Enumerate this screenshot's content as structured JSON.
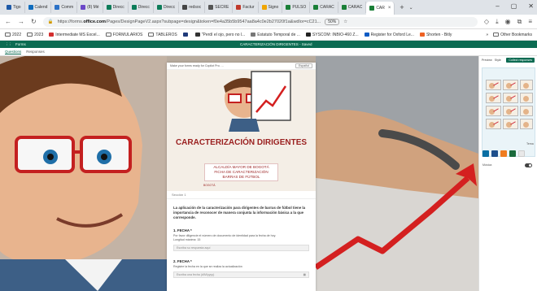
{
  "browser": {
    "tabs": [
      {
        "label": "Tigo",
        "color": "#1e5aa8"
      },
      {
        "label": "Calend",
        "color": "#0f6cbd"
      },
      {
        "label": "Comm",
        "color": "#2c72c7"
      },
      {
        "label": "(8) Mé",
        "color": "#6b47c8"
      },
      {
        "label": "Direcc",
        "color": "#0c7c59"
      },
      {
        "label": "Direcc",
        "color": "#0c7c59"
      },
      {
        "label": "Direcc",
        "color": "#0c7c59"
      },
      {
        "label": "redsoc",
        "color": "#444444"
      },
      {
        "label": "SECRE",
        "color": "#555555"
      },
      {
        "label": "Factur",
        "color": "#c0392b"
      },
      {
        "label": "Signo",
        "color": "#f0a500"
      },
      {
        "label": "PULSO",
        "color": "#1a7f37"
      },
      {
        "label": "CARAC",
        "color": "#1a7f37"
      },
      {
        "label": "CARAC",
        "color": "#1a7f37"
      },
      {
        "label": "CAR",
        "color": "#1a7f37",
        "active": true
      }
    ],
    "new_tab": "+",
    "tab_menu": "⌄",
    "url_prefix": "https://forms.",
    "url_domain": "office.com",
    "url_rest": "/Pages/DesignPageV2.aspx?subpage=design&token=f0e4a35b5b9547aa8a4c0e2b27020f1a&wdlor=cC21...",
    "zoom": "50%",
    "window_controls": [
      "–",
      "▢",
      "✕"
    ]
  },
  "bookmarks": [
    {
      "label": "2022",
      "kind": "folder"
    },
    {
      "label": "2023",
      "kind": "folder"
    },
    {
      "label": "Intermediate MS Excel...",
      "kind": "site",
      "color": "#d32f2f"
    },
    {
      "label": "FORMULARIOS",
      "kind": "folder"
    },
    {
      "label": "TABLEROS",
      "kind": "folder"
    },
    {
      "label": "",
      "kind": "site",
      "color": "#1f3a7a"
    },
    {
      "label": "\"Perdí el ojo, pero no l...",
      "kind": "site",
      "color": "#333333"
    },
    {
      "label": "Estatuto Temporal de ...",
      "kind": "site",
      "color": "#777777"
    },
    {
      "label": "SYSCOM: INBIO-460 Z...",
      "kind": "site",
      "color": "#222222"
    },
    {
      "label": "Register for Oxford Le...",
      "kind": "site",
      "color": "#0f5cc4"
    },
    {
      "label": "Shorten - Bitly",
      "kind": "site",
      "color": "#ee6123"
    }
  ],
  "bookmarks_right": [
    "»",
    "Other Bookmarks"
  ],
  "forms": {
    "app_name": "Forms",
    "doc_title": "CARACTERIZACIÓN DIRIGENTES - Saved",
    "tabs": [
      "Questions",
      "Responses"
    ],
    "panel_actions": [
      "Preview",
      "Style",
      "Collect responses"
    ]
  },
  "card": {
    "top_notice": "Make your forms ready for Copilot Pro. ...",
    "lang_button": "Español",
    "title": "CARACTERIZACIÓN DIRIGENTES",
    "subtitle": "ALCALDÍA MAYOR DE BOGOTÁ\nFICHA DE CARACTERIZACIÓN\nBARRAS DE FÚTBOL",
    "logo_text": "BOGOTÁ",
    "section_label": "Sección 1",
    "intro": "La aplicación de la caracterización para dirigentes de barras de fútbol tiene la importancia de reconocer de manera conjunta la información básica a la que corresponde.",
    "q1": {
      "title": "1. FECHA *",
      "desc": "Por favor diligencie el número de documento de identidad para la fecha de hoy.\nLongitud máxima: 15",
      "placeholder": "Escriba su respuesta aquí"
    },
    "q2": {
      "title": "2. FECHA *",
      "desc": "Registre la fecha en la que se realiza la actualización",
      "placeholder": "Escriba una fecha (d/M/yyyy)"
    }
  },
  "panel": {
    "theme_label": "Tema",
    "music_label": "Música",
    "swatches": [
      "#0a6ea3",
      "#1d4f8c",
      "#f07c1f",
      "#1a6a3b",
      "#e8e8e8"
    ],
    "background_label": "Fondo"
  }
}
